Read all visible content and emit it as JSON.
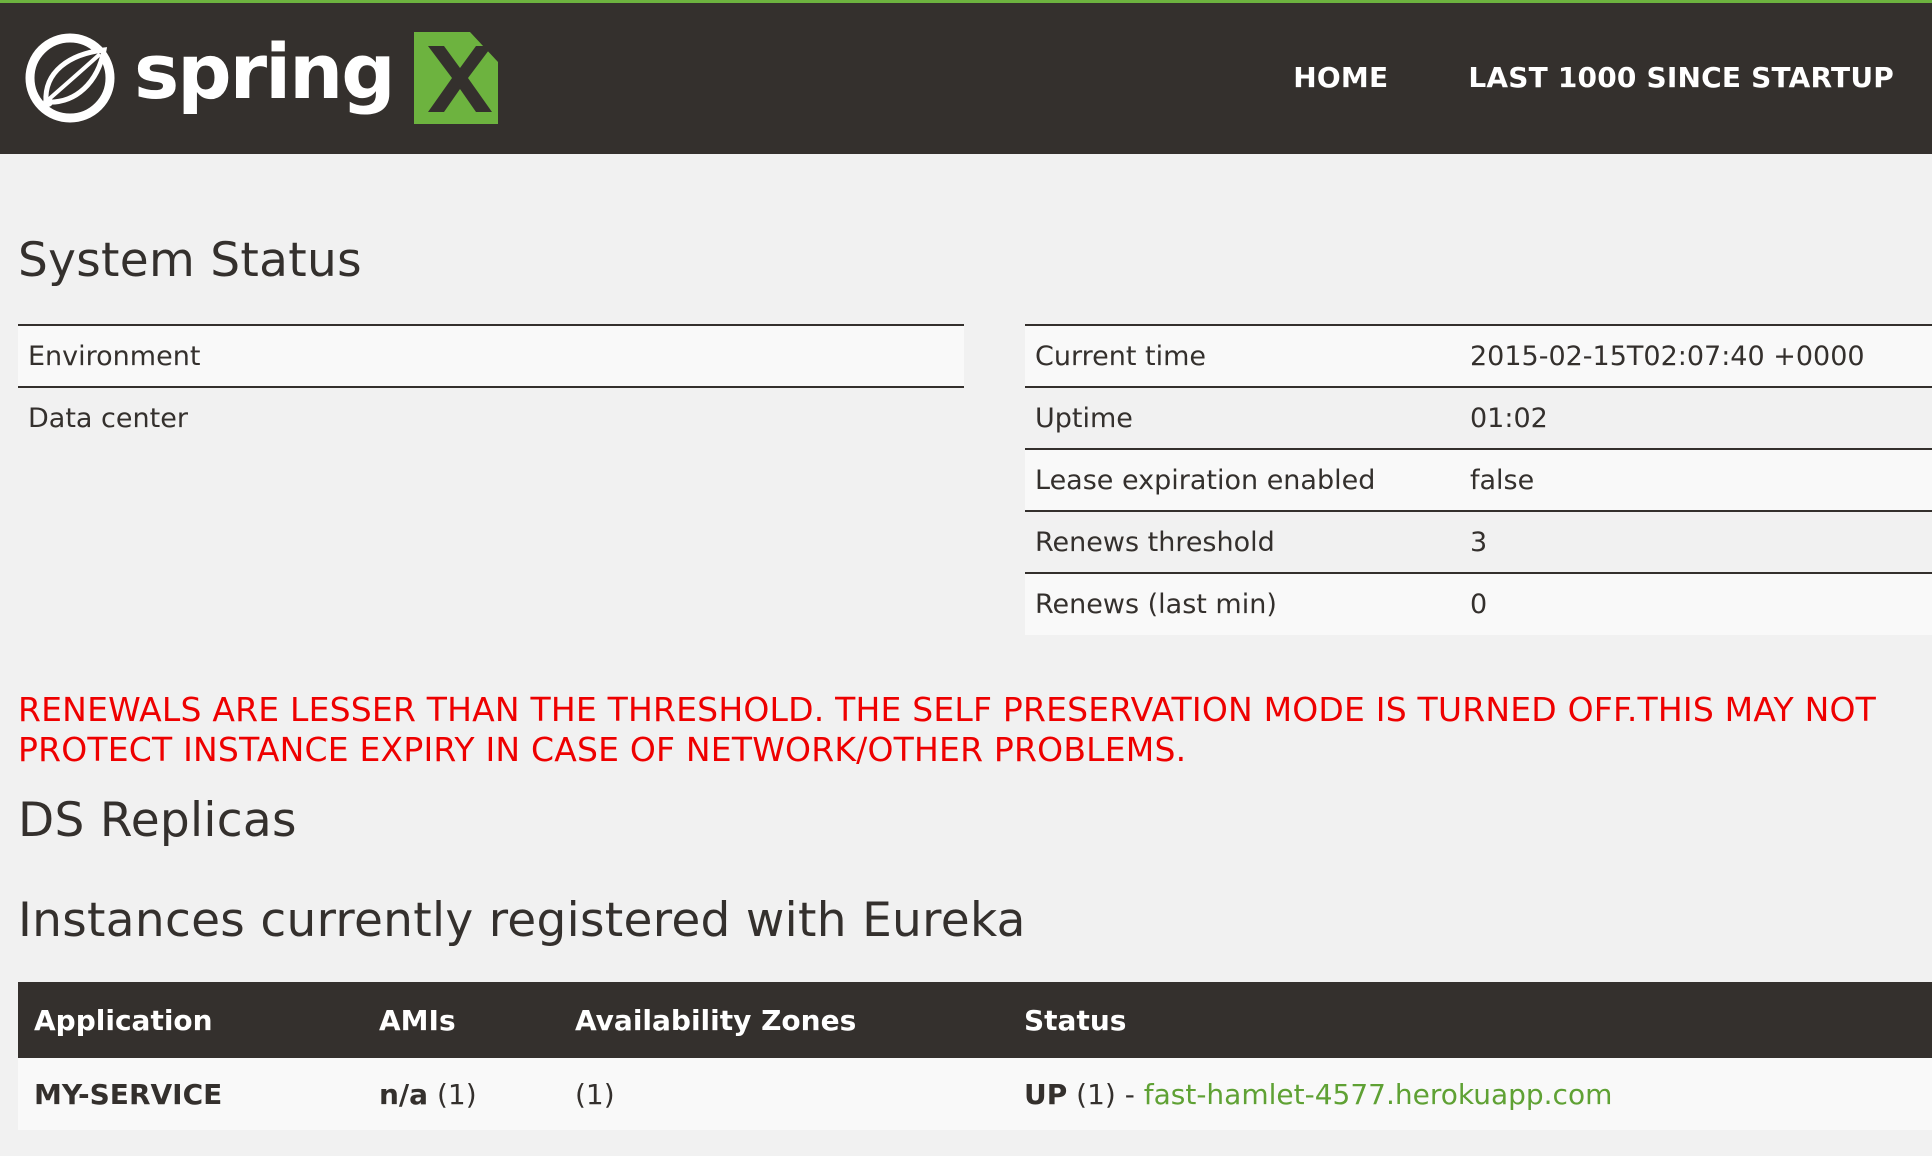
{
  "header": {
    "brand_word": "spring",
    "nav": [
      {
        "label": "HOME"
      },
      {
        "label": "LAST 1000 SINCE STARTUP"
      }
    ],
    "colors": {
      "bar": "#34302d",
      "accent": "#6db33f"
    }
  },
  "system_status": {
    "title": "System Status",
    "left_rows": [
      {
        "label": "Environment",
        "value": ""
      },
      {
        "label": "Data center",
        "value": ""
      }
    ],
    "right_rows": [
      {
        "label": "Current time",
        "value": "2015-02-15T02:07:40 +0000"
      },
      {
        "label": "Uptime",
        "value": "01:02"
      },
      {
        "label": "Lease expiration enabled",
        "value": "false"
      },
      {
        "label": "Renews threshold",
        "value": "3"
      },
      {
        "label": "Renews (last min)",
        "value": "0"
      }
    ]
  },
  "warning": {
    "text": "RENEWALS ARE LESSER THAN THE THRESHOLD. THE SELF PRESERVATION MODE IS TURNED OFF.THIS MAY NOT PROTECT INSTANCE EXPIRY IN CASE OF NETWORK/OTHER PROBLEMS.",
    "color": "#ee0000"
  },
  "ds_replicas": {
    "title": "DS Replicas"
  },
  "instances": {
    "title": "Instances currently registered with Eureka",
    "columns": [
      "Application",
      "AMIs",
      "Availability Zones",
      "Status"
    ],
    "rows": [
      {
        "application": "MY-SERVICE",
        "amis_bold": "n/a",
        "amis_count": " (1)",
        "zones": "(1)",
        "status_prefix": "UP",
        "status_count": " (1) - ",
        "status_link": "fast-hamlet-4577.herokuapp.com"
      }
    ]
  }
}
